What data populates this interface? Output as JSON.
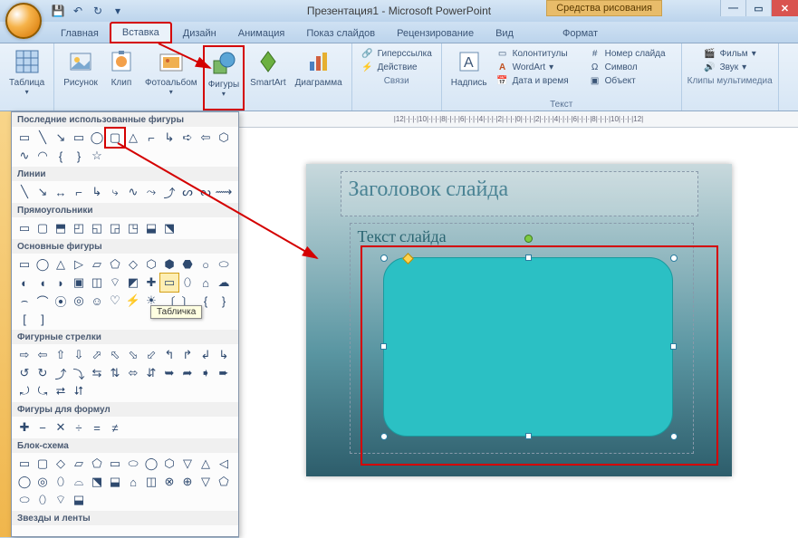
{
  "title": "Презентация1 - Microsoft PowerPoint",
  "context_tab": "Средства рисования",
  "tabs": [
    "Главная",
    "Вставка",
    "Дизайн",
    "Анимация",
    "Показ слайдов",
    "Рецензирование",
    "Вид",
    "Формат"
  ],
  "active_tab": 1,
  "ribbon": {
    "table": "Таблица",
    "picture": "Рисунок",
    "clip": "Клип",
    "album": "Фотоальбом",
    "shapes": "Фигуры",
    "smartart": "SmartArt",
    "diagram": "Диаграмма",
    "links_group": "Связи",
    "hyperlink": "Гиперссылка",
    "action": "Действие",
    "textbox": "Надпись",
    "text_group": "Текст",
    "headerfooter": "Колонтитулы",
    "wordart": "WordArt",
    "datetime": "Дата и время",
    "slidenum": "Номер слайда",
    "symbol": "Символ",
    "object": "Объект",
    "media_group": "Клипы мультимедиа",
    "movie": "Фильм",
    "sound": "Звук"
  },
  "shapes_panel": {
    "recent": "Последние использованные фигуры",
    "lines": "Линии",
    "rects": "Прямоугольники",
    "basic": "Основные фигуры",
    "block_arrows": "Фигурные стрелки",
    "formula": "Фигуры для формул",
    "flowchart": "Блок-схема",
    "stars": "Звезды и ленты",
    "tooltip": "Табличка"
  },
  "ruler_text": "|12|·|·|·|10|·|·|·|8|·|·|·|6|·|·|·|4|·|·|·|2|·|·|·|0|·|·|·|2|·|·|·|4|·|·|·|6|·|·|·|8|·|·|·|10|·|·|·|12|",
  "slide": {
    "title": "Заголовок слайда",
    "body": "Текст слайда"
  },
  "chart_data": null
}
